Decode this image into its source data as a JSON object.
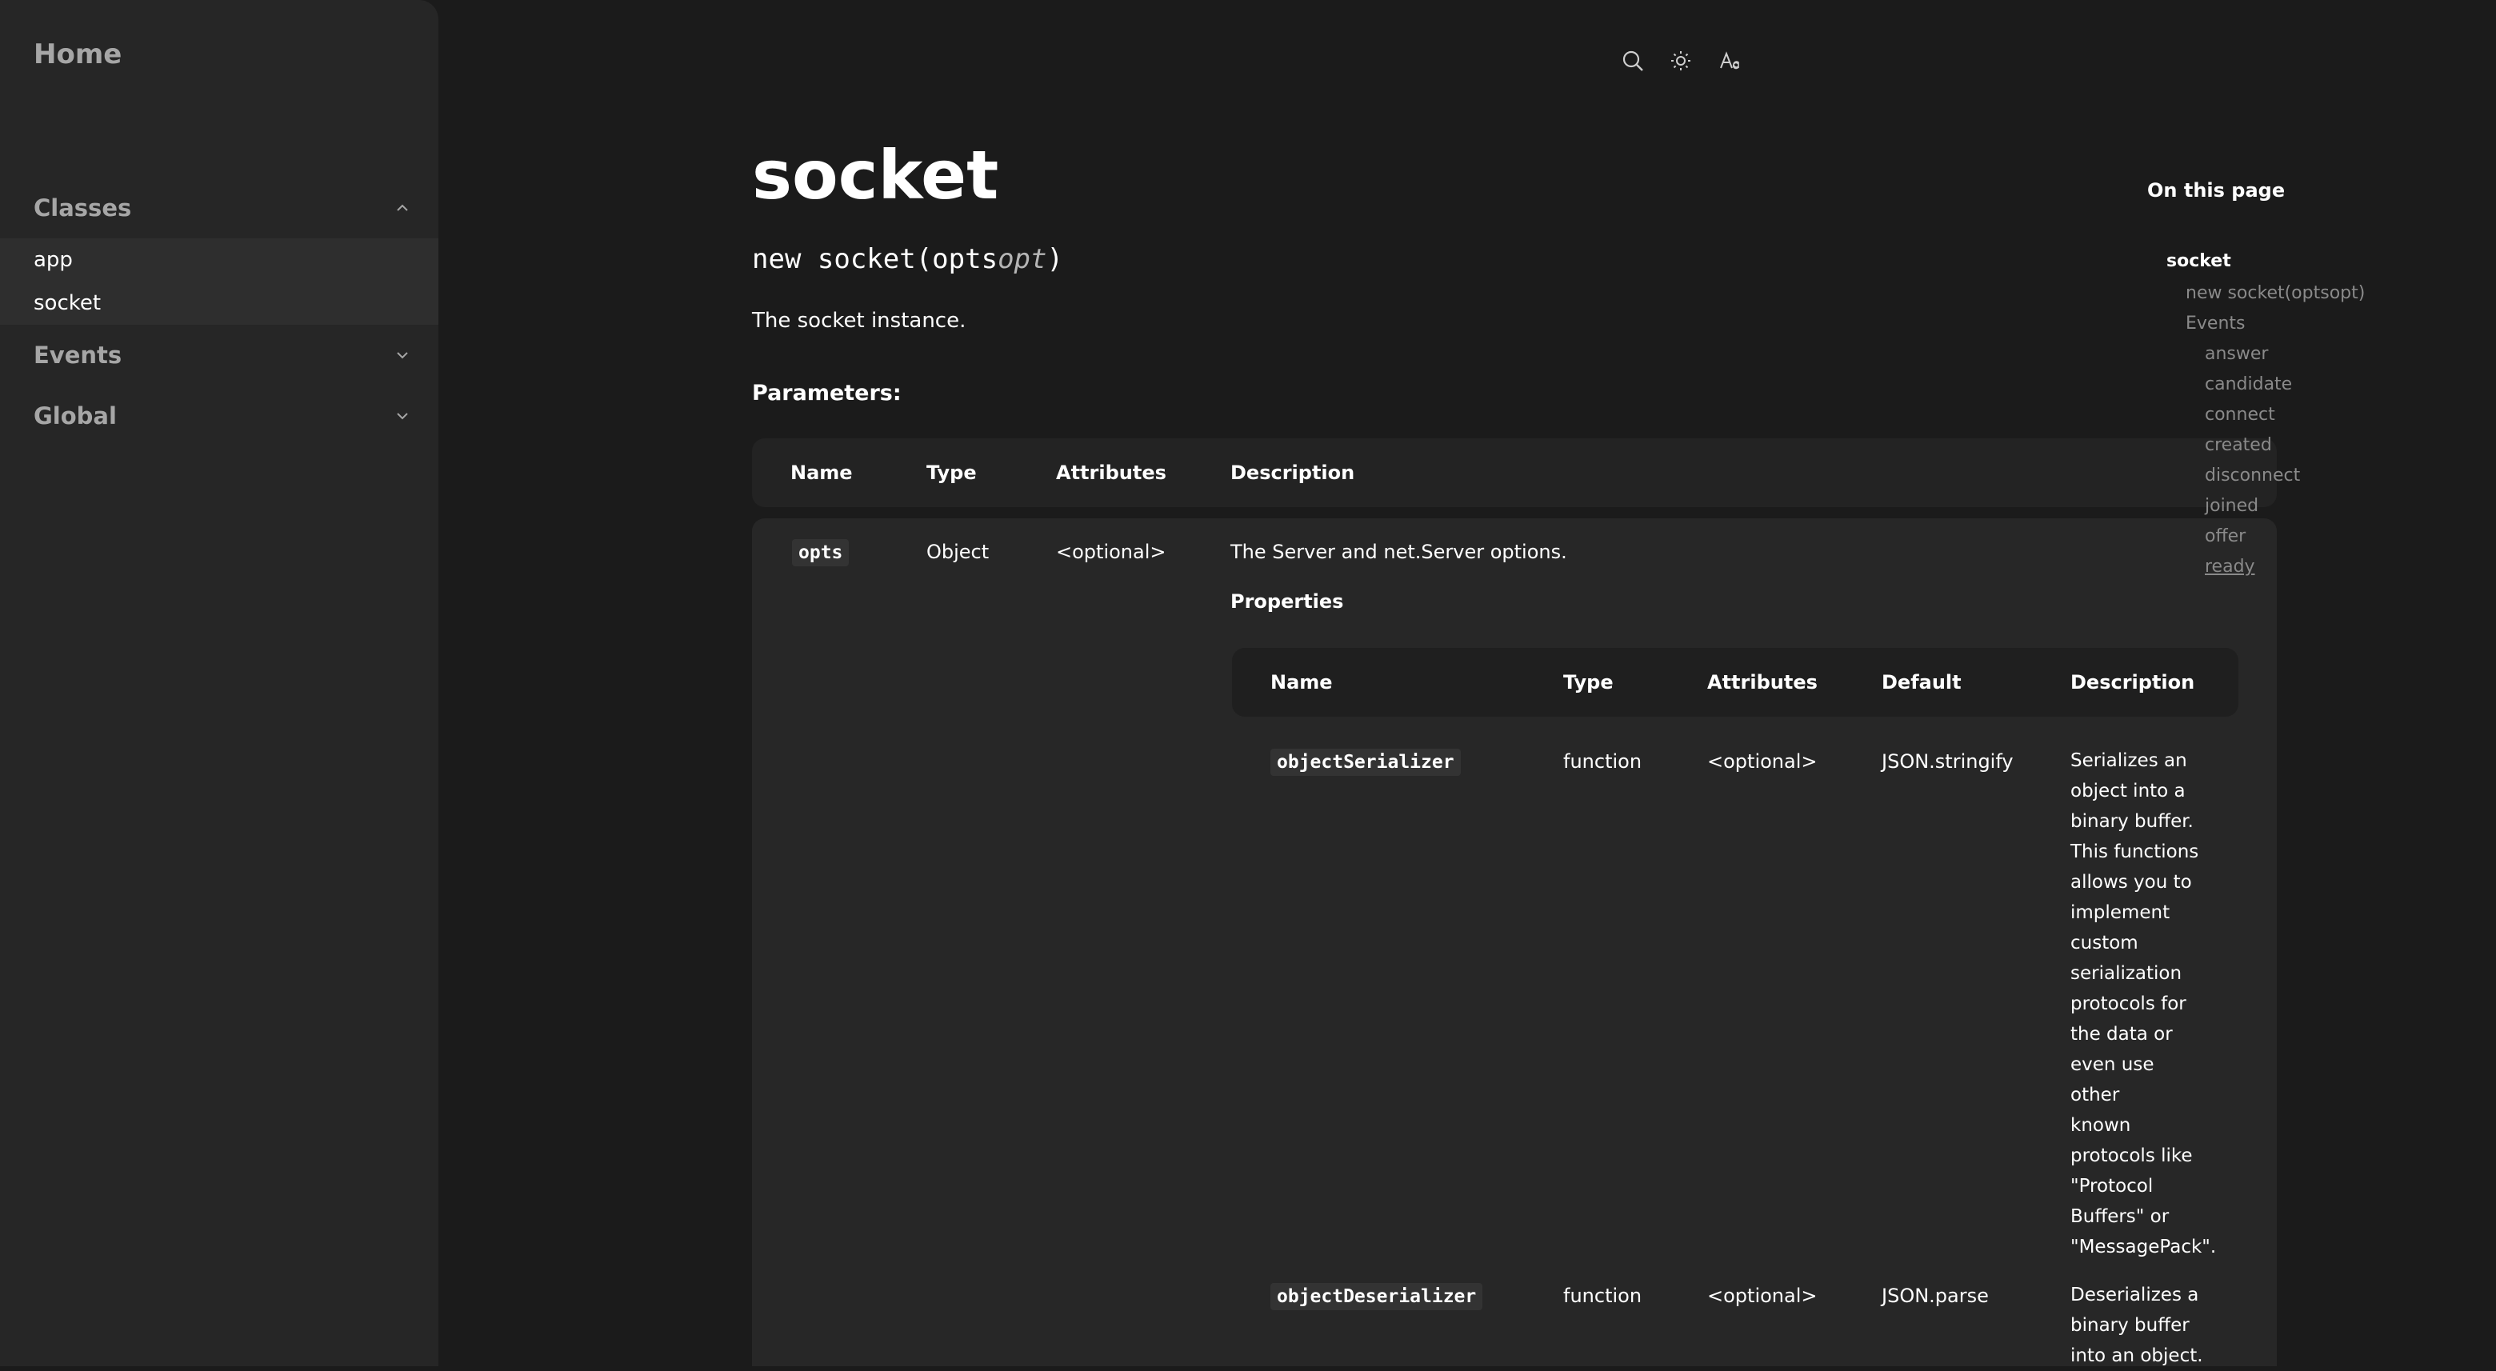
{
  "sidebar": {
    "home": "Home",
    "sections": [
      {
        "label": "Classes",
        "expanded": true,
        "items": [
          "app",
          "socket"
        ]
      },
      {
        "label": "Events",
        "expanded": false,
        "items": []
      },
      {
        "label": "Global",
        "expanded": false,
        "items": []
      }
    ]
  },
  "toolbar": {
    "icons": [
      "search-icon",
      "theme-icon",
      "font-size-icon"
    ]
  },
  "main": {
    "title": "socket",
    "signature": {
      "prefix": "new socket(",
      "param": "opts",
      "opt": "opt",
      "suffix": ")"
    },
    "intro": "The socket instance.",
    "params_label": "Parameters:",
    "params_table": {
      "headers": [
        "Name",
        "Type",
        "Attributes",
        "Description"
      ],
      "rows": [
        {
          "name": "opts",
          "type": "Object",
          "attributes": "<optional>",
          "description": "The Server and net.Server options."
        }
      ]
    },
    "properties_label": "Properties",
    "properties_table": {
      "headers": [
        "Name",
        "Type",
        "Attributes",
        "Default",
        "Description"
      ],
      "rows": [
        {
          "name": "objectSerializer",
          "type": "function",
          "attributes": "<optional>",
          "default": "JSON.stringify",
          "description": [
            "Serializes an",
            "object into a",
            "binary buffer.",
            "This functions",
            "allows you to",
            "implement",
            "custom",
            "serialization",
            "protocols for",
            "the data or",
            "even use other",
            "known",
            "protocols like",
            "\"Protocol",
            "Buffers\" or",
            "\"MessagePack\"."
          ]
        },
        {
          "name": "objectDeserializer",
          "type": "function",
          "attributes": "<optional>",
          "default": "JSON.parse",
          "description": [
            "Deserializes a",
            "binary buffer",
            "into an object."
          ]
        }
      ]
    }
  },
  "toc": {
    "title": "On this page",
    "items": [
      "socket",
      "new socket(optsopt)",
      "Events",
      "answer",
      "candidate",
      "connect",
      "created",
      "disconnect",
      "joined",
      "offer",
      "ready"
    ]
  }
}
